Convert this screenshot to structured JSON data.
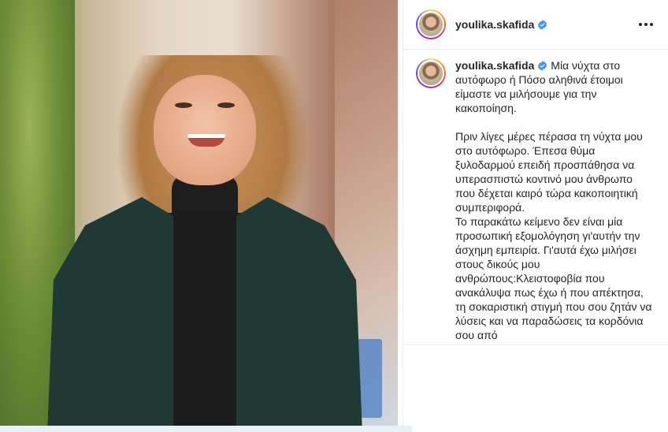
{
  "post": {
    "username": "youlika.skafida",
    "verified": true,
    "more_icon": "more-horizontal-icon",
    "image_alt": "woman smiling in dark green coat on a street"
  },
  "caption": {
    "username": "youlika.skafida",
    "paragraphs": [
      "Μία νύχτα στο αυτόφωρο ή Πόσο αληθινά έτοιμοι είμαστε να μιλήσουμε για την κακοποίηση.",
      "Πριν λίγες μέρες πέρασα τη νύχτα μου στο αυτόφωρο. Έπεσα θύμα ξυλοδαρμού επειδή προσπάθησα να υπερασπιστώ κοντινό μου άνθρωπο που δέχεται καιρό τώρα κακοποιητική συμπεριφορά.",
      "Το παρακάτω κείμενο δεν είναι μία προσωπική εξομολόγηση γι'αυτήν την άσχημη εμπειρία. Γι'αυτά έχω μιλήσει στους δικούς μου ανθρώπους:Κλειστοφοβία που ανακάλυψα πως έχω ή που απέκτησα, τη σοκαριστική στιγμή που σου ζητάν να λύσεις και να παραδώσεις τα κορδόνια σου από"
    ]
  },
  "colors": {
    "verified_blue": "#3897f0",
    "text": "#262626",
    "border": "#efefef"
  }
}
